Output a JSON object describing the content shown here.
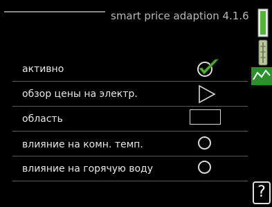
{
  "header": {
    "title": "smart price adaption 4.1.6"
  },
  "menu": {
    "items": [
      {
        "label": "активно",
        "control": "checkbox",
        "checked": true
      },
      {
        "label": "обзор цены на электр.",
        "control": "arrow"
      },
      {
        "label": "область",
        "control": "field",
        "value": ""
      },
      {
        "label": "влияние на комн. темп.",
        "control": "radio",
        "selected": false
      },
      {
        "label": "влияние на горячую воду",
        "control": "radio",
        "selected": false
      }
    ]
  },
  "sidebar": {
    "icons": [
      "scrollbar-icon",
      "thermometer-icon",
      "price-graph-icon"
    ]
  },
  "help": {
    "label": "?"
  },
  "colors": {
    "accent_green": "#52b535",
    "background": "#000000",
    "text": "#e6e6e6"
  }
}
